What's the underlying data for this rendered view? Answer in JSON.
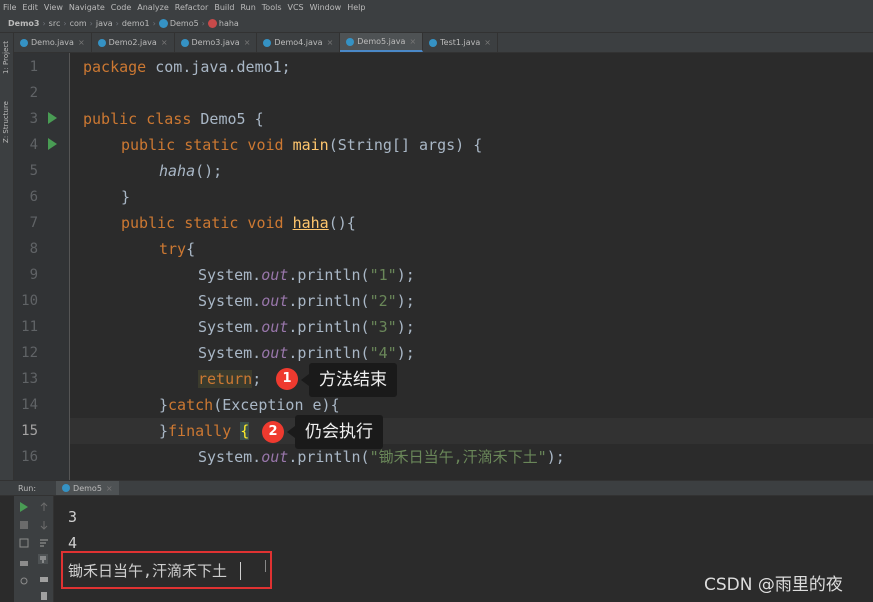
{
  "menu": [
    "File",
    "Edit",
    "View",
    "Navigate",
    "Code",
    "Analyze",
    "Refactor",
    "Build",
    "Run",
    "Tools",
    "VCS",
    "Window",
    "Help"
  ],
  "breadcrumb": [
    "Demo3",
    "src",
    "com",
    "java",
    "demo1",
    "Demo5",
    "haha"
  ],
  "toolstrip": {
    "project_label": "1: Project",
    "structure_label": "Z: Structure"
  },
  "tabs": [
    {
      "label": "Demo.java",
      "active": false
    },
    {
      "label": "Demo2.java",
      "active": false
    },
    {
      "label": "Demo3.java",
      "active": false
    },
    {
      "label": "Demo4.java",
      "active": false
    },
    {
      "label": "Demo5.java",
      "active": true
    },
    {
      "label": "Test1.java",
      "active": false
    }
  ],
  "code": {
    "line_numbers": [
      "1",
      "2",
      "3",
      "4",
      "5",
      "6",
      "7",
      "8",
      "9",
      "10",
      "11",
      "12",
      "13",
      "14",
      "15",
      "16"
    ],
    "l1_kw": "package",
    "l1_rest": " com.java.demo1;",
    "l3_kw": "public class",
    "l3_rest": " Demo5 {",
    "l4_kw": "public static void",
    "l4_fn": "main",
    "l4_rest": "(String[] args) {",
    "l5_call": "haha",
    "l5_rest": "();",
    "l6_text": "}",
    "l7_kw": "public static void",
    "l7_fn": "haha",
    "l7_rest": "(){",
    "l8_kw": "try",
    "l8_rest": "{",
    "sys": "System.",
    "out": "out",
    "println": ".println(",
    "close": ");",
    "s1": "\"1\"",
    "s2": "\"2\"",
    "s3": "\"3\"",
    "s4": "\"4\"",
    "l13_kw": "return",
    "l13_rest": ";",
    "l14_pre": "}",
    "l14_kw": "catch",
    "l14_rest": "(Exception e){",
    "l15_pre": "}",
    "l15_kw": "finally",
    "l15_brace": "{",
    "s16": "\"锄禾日当午,汗滴禾下土\""
  },
  "annotations": [
    {
      "number": "1",
      "text": "方法结束"
    },
    {
      "number": "2",
      "text": "仍会执行"
    }
  ],
  "run_panel": {
    "label": "Run:",
    "tab": "Demo5"
  },
  "console": [
    "3",
    "4",
    "锄禾日当午,汗滴禾下土"
  ],
  "watermark": "CSDN @雨里的夜"
}
